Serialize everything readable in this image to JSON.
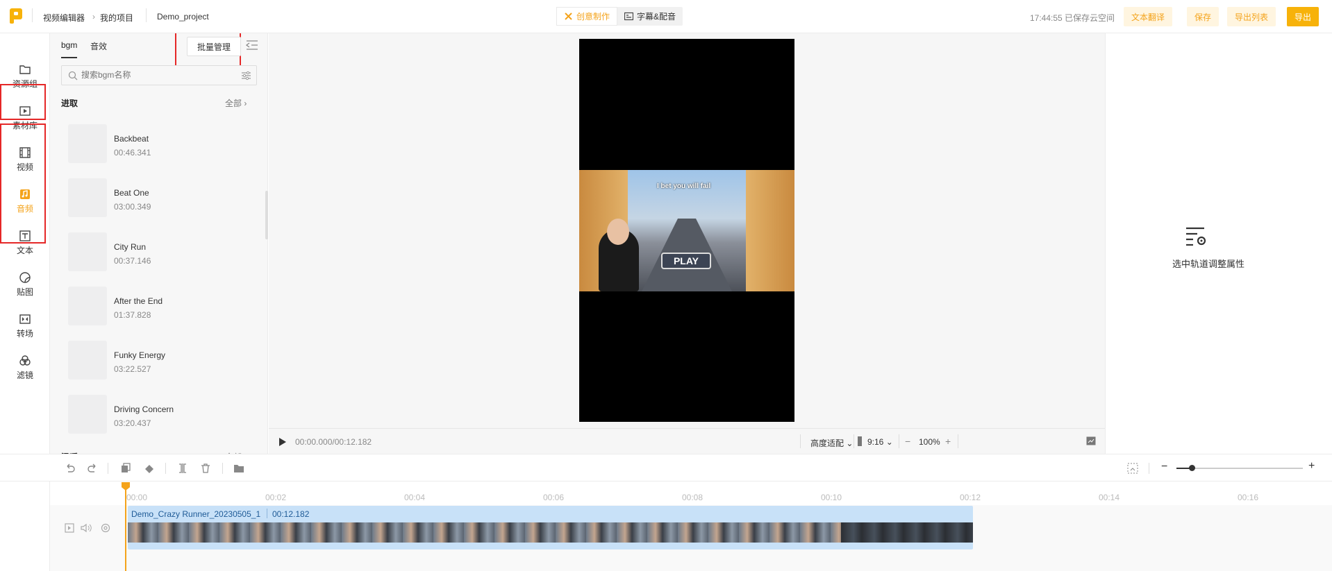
{
  "header": {
    "breadcrumb": [
      "视频编辑器",
      "我的项目"
    ],
    "project_name": "Demo_project",
    "center_tabs": [
      {
        "label": "创意制作",
        "active": true
      },
      {
        "label": "字幕&配音",
        "active": false
      }
    ],
    "save_status": "17:44:55 已保存云空间",
    "buttons": {
      "translate": "文本翻译",
      "save": "保存",
      "export_list": "导出列表",
      "export": "导出"
    },
    "accent": "#f4a31b"
  },
  "rail": [
    {
      "label": "资源组",
      "icon": "folder-icon"
    },
    {
      "label": "素材库",
      "icon": "media-library-icon"
    },
    {
      "label": "视频",
      "icon": "film-icon"
    },
    {
      "label": "音频",
      "icon": "music-icon",
      "active": true
    },
    {
      "label": "文本",
      "icon": "text-icon"
    },
    {
      "label": "贴图",
      "icon": "sticker-icon"
    },
    {
      "label": "转场",
      "icon": "transition-icon"
    },
    {
      "label": "滤镜",
      "icon": "filter-icon"
    }
  ],
  "panel": {
    "tabs": [
      {
        "label": "bgm",
        "active": true
      },
      {
        "label": "音效",
        "active": false
      }
    ],
    "batch_button": "批量管理",
    "search_placeholder": "搜索bgm名称",
    "section": {
      "title": "进取",
      "all_label": "全部"
    },
    "next_section": {
      "title": "温暖",
      "all_label": "全部"
    },
    "tracks": [
      {
        "name": "Backbeat",
        "duration": "00:46.341"
      },
      {
        "name": "Beat One",
        "duration": "03:00.349"
      },
      {
        "name": "City Run",
        "duration": "00:37.146"
      },
      {
        "name": "After the End",
        "duration": "01:37.828"
      },
      {
        "name": "Funky Energy",
        "duration": "03:22.527"
      },
      {
        "name": "Driving Concern",
        "duration": "03:20.437"
      }
    ]
  },
  "preview": {
    "overlay_text": "I bet you will fail",
    "game_button": "PLAY",
    "time": "00:00.000/00:12.182",
    "fit_mode": "高度适配",
    "ratio": "9:16",
    "zoom": "100%"
  },
  "properties": {
    "hint": "选中轨道调整属性"
  },
  "timeline": {
    "ticks": [
      "00:00",
      "00:02",
      "00:04",
      "00:06",
      "00:08",
      "00:10",
      "00:12",
      "00:14",
      "00:16"
    ],
    "clip_name": "Demo_Crazy Runner_20230505_1",
    "clip_duration": "00:12.182"
  }
}
